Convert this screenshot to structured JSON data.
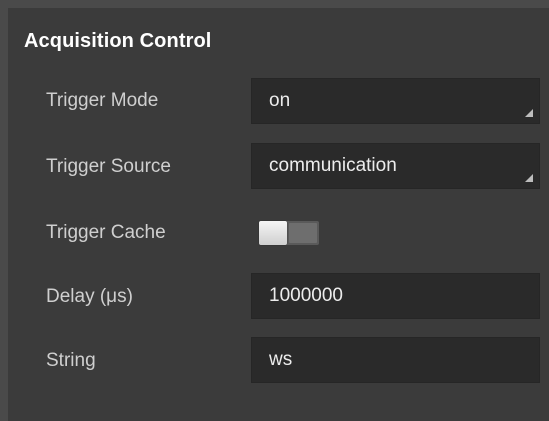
{
  "section": {
    "title": "Acquisition Control"
  },
  "rows": [
    {
      "label": "Trigger Mode",
      "type": "combo",
      "value": "on"
    },
    {
      "label": "Trigger Source",
      "type": "combo",
      "value": "communication"
    },
    {
      "label": "Trigger Cache",
      "type": "toggle",
      "state": "off"
    },
    {
      "label": "Delay (μs)",
      "type": "input",
      "value": "1000000"
    },
    {
      "label": "String",
      "type": "input",
      "value": "ws"
    }
  ],
  "colors": {
    "panel_bg": "#3b3b3b",
    "field_bg": "#2a2a2a",
    "text": "#d8d8d8",
    "header_text": "#ffffff"
  }
}
